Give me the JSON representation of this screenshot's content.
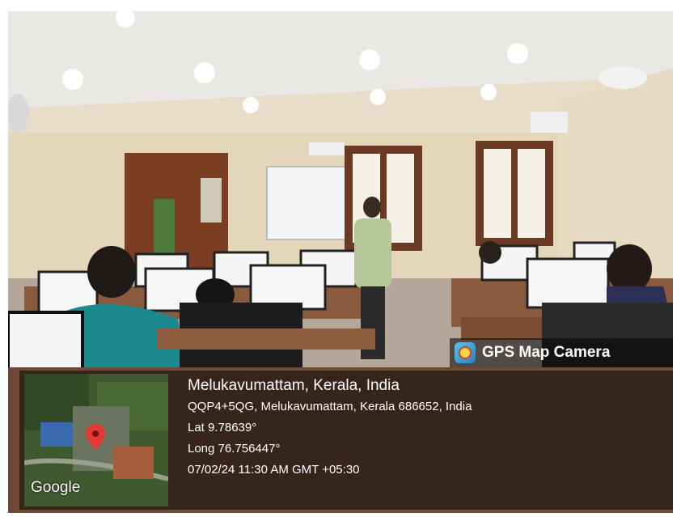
{
  "badge": {
    "title": "GPS Map Camera",
    "icon": "camera-pin-icon"
  },
  "map": {
    "attribution": "Google"
  },
  "location": {
    "place": "Melukavumattam, Kerala, India",
    "address": "QQP4+5QG, Melukavumattam, Kerala 686652, India",
    "latitude": "Lat 9.78639°",
    "longitude": "Long 76.756447°",
    "datetime": "07/02/24 11:30 AM GMT +05:30"
  },
  "colors": {
    "overlay": "#000000",
    "text": "#ffffff",
    "pin": "#e53935"
  }
}
